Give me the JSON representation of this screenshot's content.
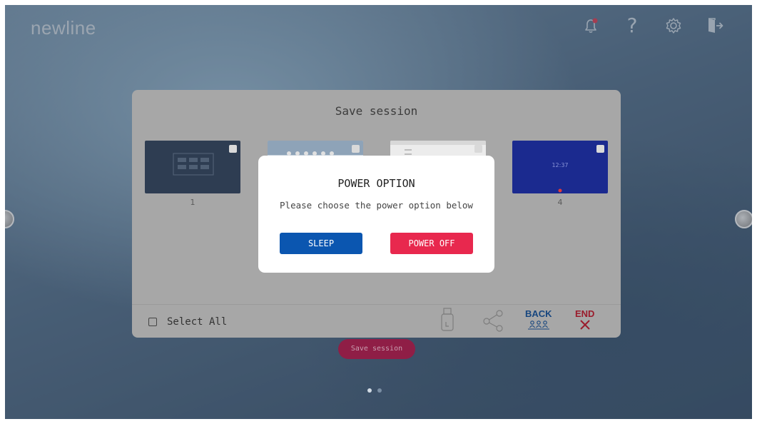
{
  "app": {
    "logo": "newline"
  },
  "topbar": {
    "icons": [
      "bell-icon",
      "help-icon",
      "settings-icon",
      "exit-icon"
    ],
    "help_glyph": "?"
  },
  "save_panel": {
    "title": "Save session",
    "thumbnails": [
      {
        "label": "1",
        "background": "#2e3d52"
      },
      {
        "label": "",
        "background": "#c4cfdb"
      },
      {
        "label": "",
        "background": "#ececec"
      },
      {
        "label": "4",
        "background": "#1b2a8f",
        "clock": "12:37"
      }
    ],
    "select_all_label": "Select All",
    "footer": {
      "back_label": "BACK",
      "end_label": "END"
    }
  },
  "save_session_button": {
    "label": "Save session"
  },
  "pager": {
    "count": 2,
    "active": 0
  },
  "modal": {
    "title": "POWER OPTION",
    "message": "Please choose the power option below",
    "sleep_label": "SLEEP",
    "power_off_label": "POWER OFF"
  },
  "colors": {
    "sleep": "#0b56b0",
    "power_off": "#e8284e",
    "back": "#17467f",
    "end": "#9a1c2c",
    "save_button": "#8f1e46"
  }
}
